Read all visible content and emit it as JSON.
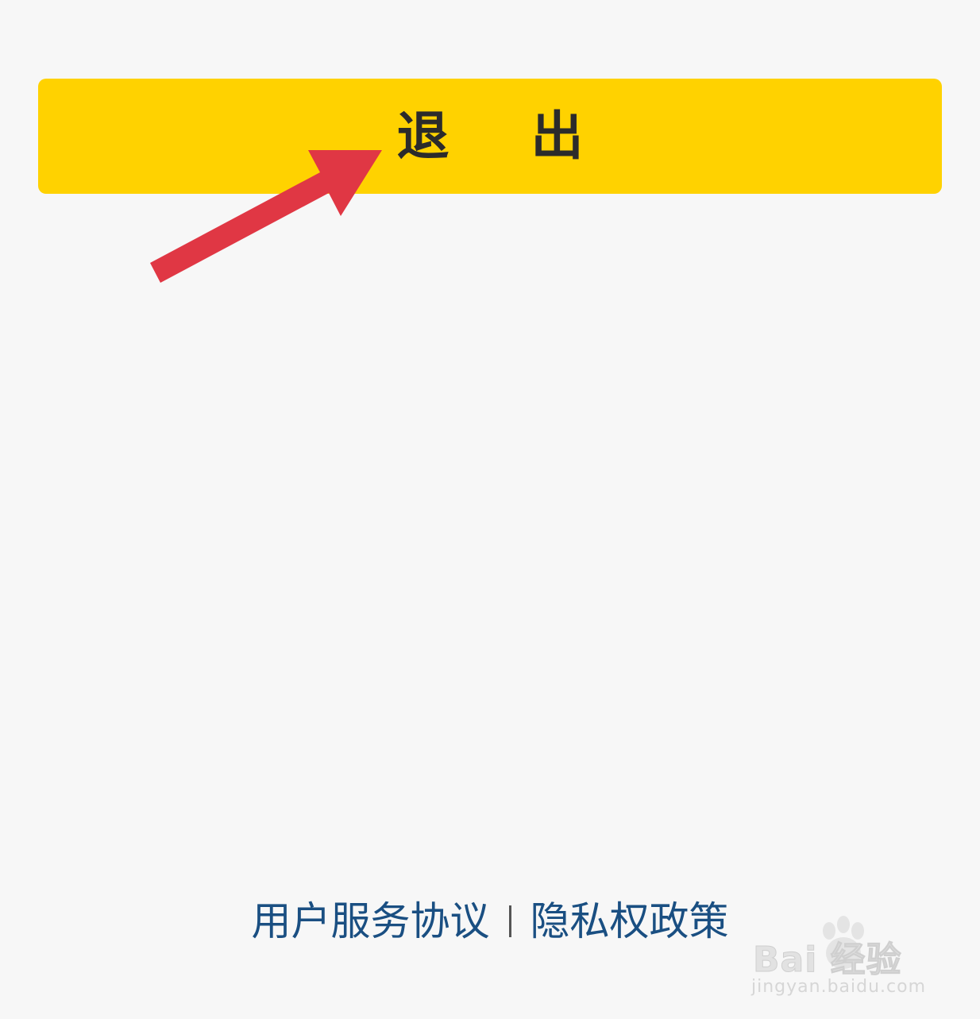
{
  "logout_button": {
    "label": "退 出",
    "color": "#ffd200"
  },
  "annotation": {
    "arrow_color": "#e03744"
  },
  "footer": {
    "user_agreement": "用户服务协议",
    "privacy_policy": "隐私权政策",
    "link_color": "#1a4f82"
  },
  "watermark": {
    "brand": "Bai 经验",
    "url": "jingyan.baidu.com"
  }
}
